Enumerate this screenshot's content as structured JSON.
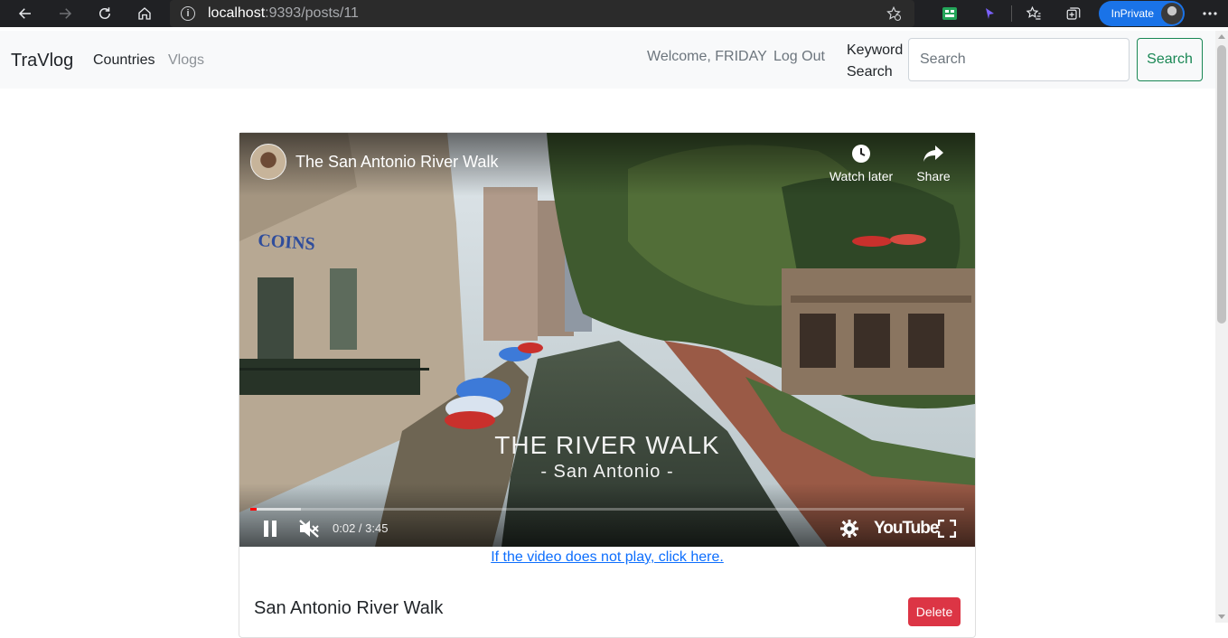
{
  "browser": {
    "url_host": "localhost",
    "url_path": ":9393/posts/11",
    "inprivate_label": "InPrivate"
  },
  "navbar": {
    "brand": "TraVlog",
    "links": [
      {
        "label": "Countries",
        "active": true
      },
      {
        "label": "Vlogs",
        "active": false
      }
    ],
    "welcome": "Welcome, FRIDAY",
    "logout": "Log Out",
    "keyword_label_line1": "Keyword",
    "keyword_label_line2": "Search",
    "search_placeholder": "Search",
    "search_button": "Search"
  },
  "video": {
    "title": "The San Antonio River Walk",
    "watch_later": "Watch later",
    "share": "Share",
    "overlay_title": "THE RIVER WALK",
    "overlay_subtitle": "- San Antonio -",
    "sign_text": "COINS",
    "time": "0:02 / 3:45",
    "played_fraction": 0.009,
    "buffered_fraction": 0.071,
    "youtube_logo": "YouTube",
    "is_playing": true,
    "is_muted": true
  },
  "post": {
    "fallback_link": "If the video does not play, click here.",
    "title": "San Antonio River Walk",
    "delete_button": "Delete"
  },
  "colors": {
    "brand_green": "#198754",
    "link_blue": "#0d6efd",
    "danger_red": "#dc3545",
    "yt_red": "#ff0000",
    "browser_dark": "#202124"
  }
}
